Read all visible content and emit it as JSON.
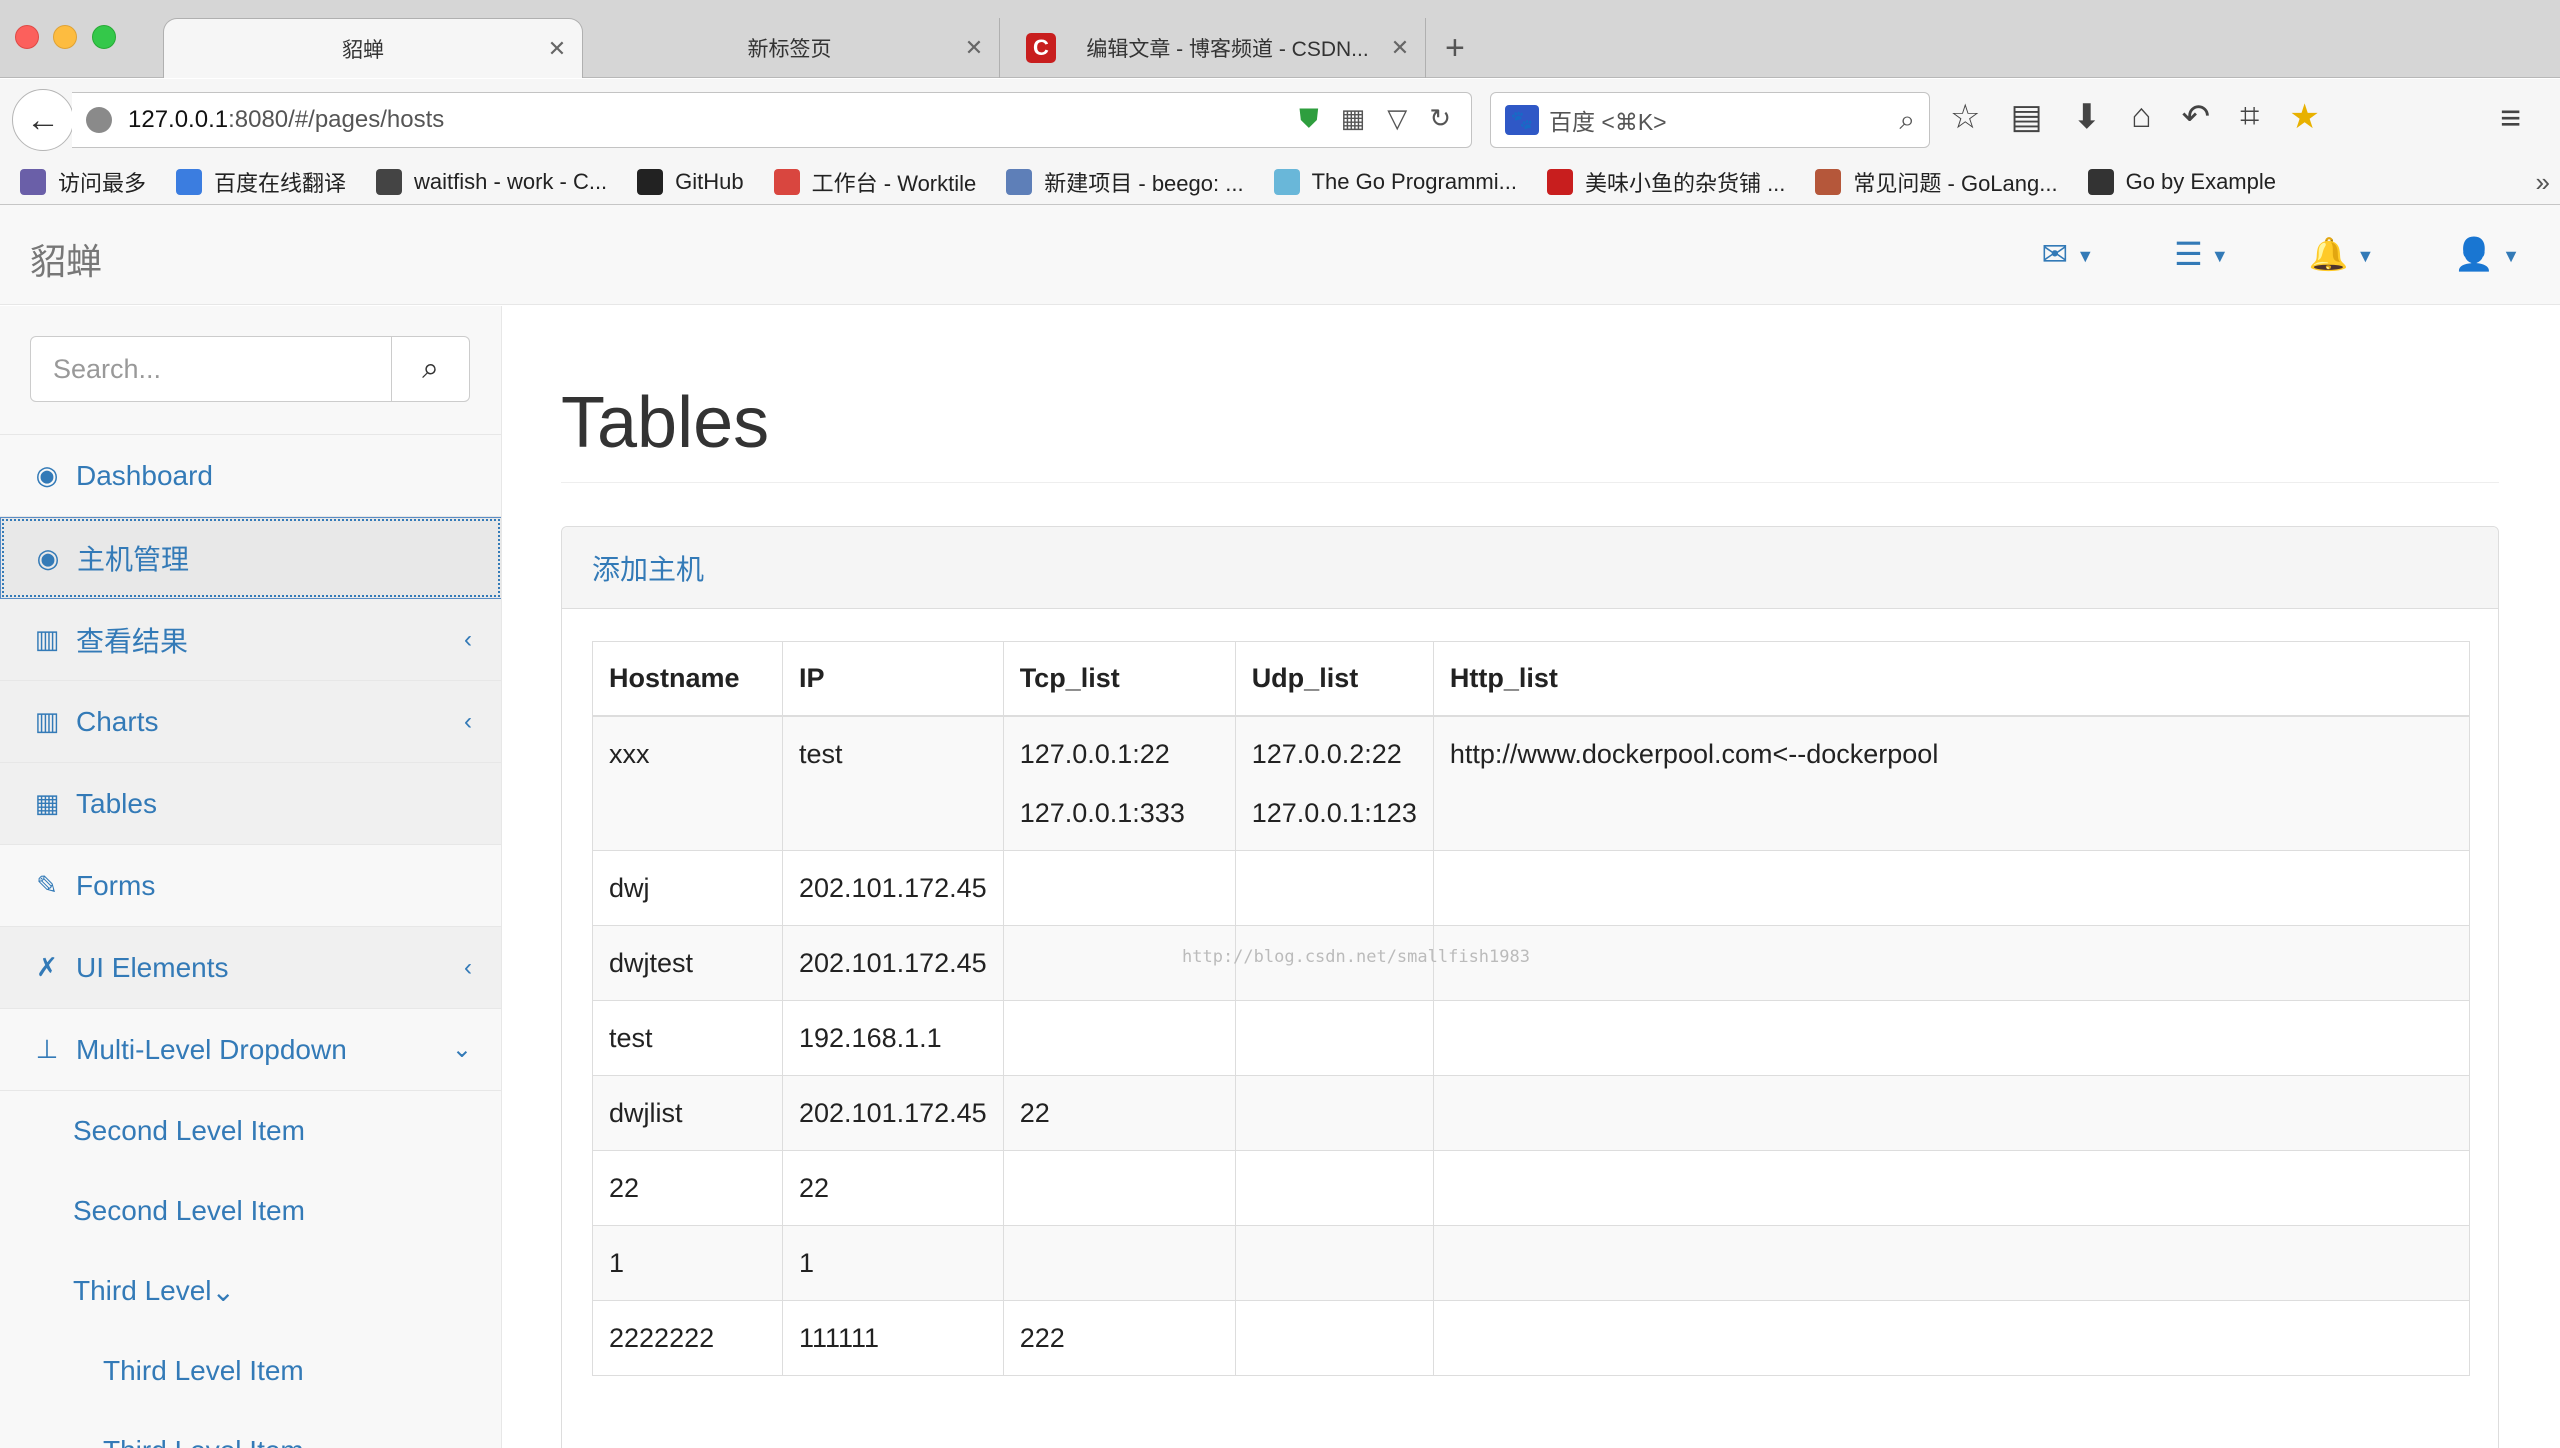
{
  "browser": {
    "tabs": [
      {
        "title": "貂蝉",
        "active": true
      },
      {
        "title": "新标签页",
        "active": false
      },
      {
        "title": "编辑文章 - 博客频道 - CSDN...",
        "active": false,
        "favicon": "C"
      }
    ],
    "url_host": "127.0.0.1",
    "url_rest": ":8080/#/pages/hosts",
    "search_placeholder": "百度 <⌘K>",
    "bookmarks": [
      {
        "label": "访问最多",
        "icon": "folder-icon",
        "color": "#6a5fa8"
      },
      {
        "label": "百度在线翻译",
        "icon": "translate-icon",
        "color": "#3b7de0"
      },
      {
        "label": "waitfish - work - C...",
        "icon": "fish-icon",
        "color": "#444444"
      },
      {
        "label": "GitHub",
        "icon": "github-icon",
        "color": "#222222"
      },
      {
        "label": "工作台 - Worktile",
        "icon": "worktile-icon",
        "color": "#d9463f"
      },
      {
        "label": "新建项目 - beego: ...",
        "icon": "beego-icon",
        "color": "#5e7fb8"
      },
      {
        "label": "The Go Programmi...",
        "icon": "gopher-icon",
        "color": "#69b7d9"
      },
      {
        "label": "美味小鱼的杂货铺 ...",
        "icon": "csdn-icon",
        "color": "#c81e1e"
      },
      {
        "label": "常见问题 - GoLang...",
        "icon": "golang-icon",
        "color": "#b5573a"
      },
      {
        "label": "Go by Example",
        "icon": "braces-icon",
        "color": "#333333"
      }
    ]
  },
  "app": {
    "brand": "貂蝉",
    "search_placeholder": "Search...",
    "nav": [
      {
        "label": "Dashboard",
        "icon": "dashboard-icon",
        "glyph": "◉",
        "arrow": ""
      },
      {
        "label": "主机管理",
        "icon": "dashboard-icon",
        "glyph": "◉",
        "arrow": "",
        "active": true
      },
      {
        "label": "查看结果",
        "icon": "bar-chart-icon",
        "glyph": "▥",
        "arrow": "‹"
      },
      {
        "label": "Charts",
        "icon": "bar-chart-icon",
        "glyph": "▥",
        "arrow": "‹"
      },
      {
        "label": "Tables",
        "icon": "table-icon",
        "glyph": "▦",
        "arrow": ""
      },
      {
        "label": "Forms",
        "icon": "edit-icon",
        "glyph": "✎",
        "arrow": ""
      },
      {
        "label": "UI Elements",
        "icon": "wrench-icon",
        "glyph": "✗",
        "arrow": "‹"
      },
      {
        "label": "Multi-Level Dropdown",
        "icon": "sitemap-icon",
        "glyph": "⊥",
        "arrow": "⌄"
      }
    ],
    "sub_nav": [
      {
        "label": "Second Level Item",
        "level": 2
      },
      {
        "label": "Second Level Item",
        "level": 2
      },
      {
        "label": "Third Level",
        "level": 2,
        "arrow": "⌄"
      },
      {
        "label": "Third Level Item",
        "level": 3
      },
      {
        "label": "Third Level Item",
        "level": 3
      }
    ],
    "page_title": "Tables",
    "panel_heading": "添加主机",
    "watermark": "http://blog.csdn.net/smallfish1983",
    "table": {
      "headers": [
        "Hostname",
        "IP",
        "Tcp_list",
        "Udp_list",
        "Http_list"
      ],
      "rows": [
        {
          "hostname": "xxx",
          "ip": "test",
          "tcp": [
            "127.0.0.1:22",
            "127.0.0.1:333"
          ],
          "udp": [
            "127.0.0.2:22",
            "127.0.0.1:123"
          ],
          "http": [
            "http://www.dockerpool.com<--dockerpool"
          ]
        },
        {
          "hostname": "dwj",
          "ip": "202.101.172.45",
          "tcp": [],
          "udp": [],
          "http": []
        },
        {
          "hostname": "dwjtest",
          "ip": "202.101.172.45",
          "tcp": [],
          "udp": [],
          "http": []
        },
        {
          "hostname": "test",
          "ip": "192.168.1.1",
          "tcp": [],
          "udp": [],
          "http": []
        },
        {
          "hostname": "dwjlist",
          "ip": "202.101.172.45",
          "tcp": [
            "22"
          ],
          "udp": [],
          "http": []
        },
        {
          "hostname": "22",
          "ip": "22",
          "tcp": [],
          "udp": [],
          "http": []
        },
        {
          "hostname": "1",
          "ip": "1",
          "tcp": [],
          "udp": [],
          "http": []
        },
        {
          "hostname": "2222222",
          "ip": "111111",
          "tcp": [
            "222"
          ],
          "udp": [],
          "http": []
        }
      ]
    }
  }
}
